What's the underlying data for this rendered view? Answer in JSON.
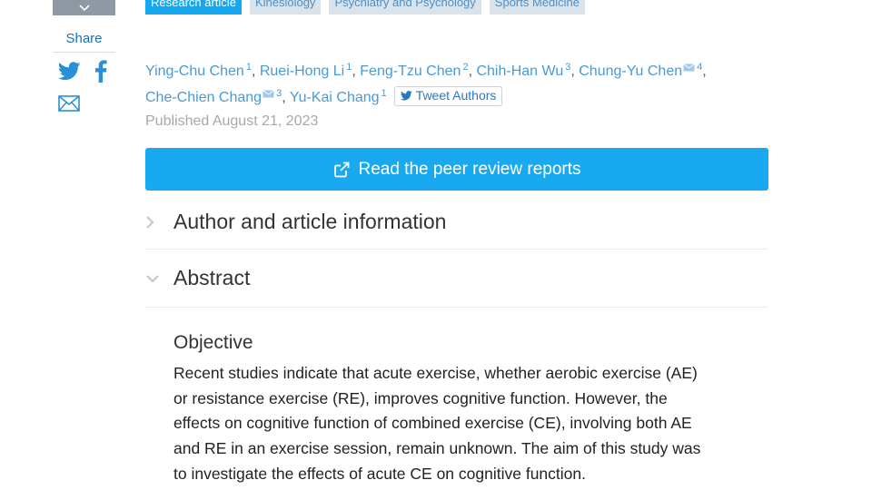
{
  "sidebar": {
    "share_label": "Share",
    "icons": [
      "chevron-down-icon",
      "twitter-icon",
      "facebook-icon",
      "mail-icon"
    ]
  },
  "tags": [
    "Research article",
    "Kinesiology",
    "Psychiatry and Psychology",
    "Sports Medicine"
  ],
  "authors": [
    {
      "name": "Ying-Chu Chen",
      "aff": "1",
      "corresponding": false,
      "sep": ","
    },
    {
      "name": "Ruei-Hong Li",
      "aff": "1",
      "corresponding": false,
      "sep": ","
    },
    {
      "name": "Feng-Tzu Chen",
      "aff": "2",
      "corresponding": false,
      "sep": ","
    },
    {
      "name": "Chih-Han Wu",
      "aff": "3",
      "corresponding": false,
      "sep": ","
    },
    {
      "name": "Chung-Yu Chen",
      "aff": "4",
      "corresponding": true,
      "sep": ","
    },
    {
      "name": "Che-Chien Chang",
      "aff": "3",
      "corresponding": true,
      "sep": ","
    },
    {
      "name": "Yu-Kai Chang",
      "aff": "1",
      "corresponding": false,
      "sep": ""
    }
  ],
  "tweet_authors_label": "Tweet Authors",
  "published": "Published August 21, 2023",
  "peer_review_label": "Read the peer review reports",
  "sections": {
    "author_info": "Author and article information",
    "abstract": "Abstract"
  },
  "abstract": {
    "heading": "Objective",
    "lines": [
      "Recent studies indicate that acute exercise, whether aerobic exercise (AE)",
      "or resistance exercise (RE), improves cognitive function. However, the",
      "effects on cognitive function of combined exercise (CE), involving both AE",
      "and RE in an exercise session, remain unknown. The aim of this study was",
      "to investigate the effects of acute CE on cognitive function."
    ]
  },
  "colors": {
    "accent": "#18a9f0",
    "link": "#4a9ad4",
    "tag_bg": "#dbe3ea",
    "rail": "#8e99a3"
  }
}
